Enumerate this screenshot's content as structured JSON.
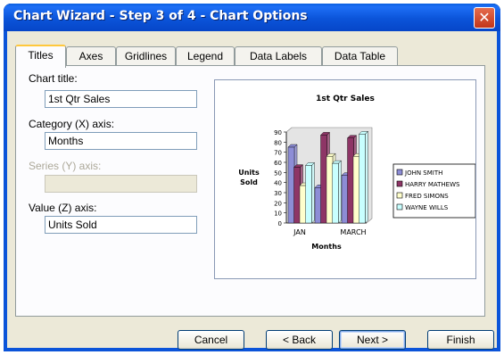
{
  "window": {
    "title": "Chart Wizard - Step 3 of 4 - Chart Options"
  },
  "tabs": [
    {
      "label": "Titles",
      "active": true
    },
    {
      "label": "Axes",
      "active": false
    },
    {
      "label": "Gridlines",
      "active": false
    },
    {
      "label": "Legend",
      "active": false
    },
    {
      "label": "Data Labels",
      "active": false
    },
    {
      "label": "Data Table",
      "active": false
    }
  ],
  "fields": {
    "chart_title": {
      "label": "Chart title:",
      "value": "1st Qtr Sales"
    },
    "category_axis": {
      "label": "Category (X) axis:",
      "value": "Months"
    },
    "series_axis": {
      "label": "Series (Y) axis:",
      "value": "",
      "disabled": true
    },
    "value_axis": {
      "label": "Value (Z) axis:",
      "value": "Units Sold"
    }
  },
  "buttons": {
    "cancel": "Cancel",
    "back": "< Back",
    "next": "Next >",
    "finish": "Finish"
  },
  "colors": {
    "series": [
      "#8d8dd6",
      "#8e3566",
      "#ffffcc",
      "#c8ffff"
    ]
  },
  "chart_data": {
    "type": "bar",
    "title": "1st Qtr Sales",
    "xlabel": "Months",
    "ylabel": "Units Sold",
    "categories": [
      "JAN",
      "",
      "MARCH"
    ],
    "ylim": [
      0,
      90
    ],
    "yticks": [
      0,
      10,
      20,
      30,
      40,
      50,
      60,
      70,
      80,
      90
    ],
    "series": [
      {
        "name": "JOHN SMITH",
        "values": [
          75,
          35,
          47
        ]
      },
      {
        "name": "HARRY MATHEWS",
        "values": [
          55,
          87,
          84
        ]
      },
      {
        "name": "FRED SIMONS",
        "values": [
          37,
          66,
          66
        ]
      },
      {
        "name": "WAYNE WILLS",
        "values": [
          57,
          59,
          88
        ]
      }
    ],
    "legend": "right"
  }
}
